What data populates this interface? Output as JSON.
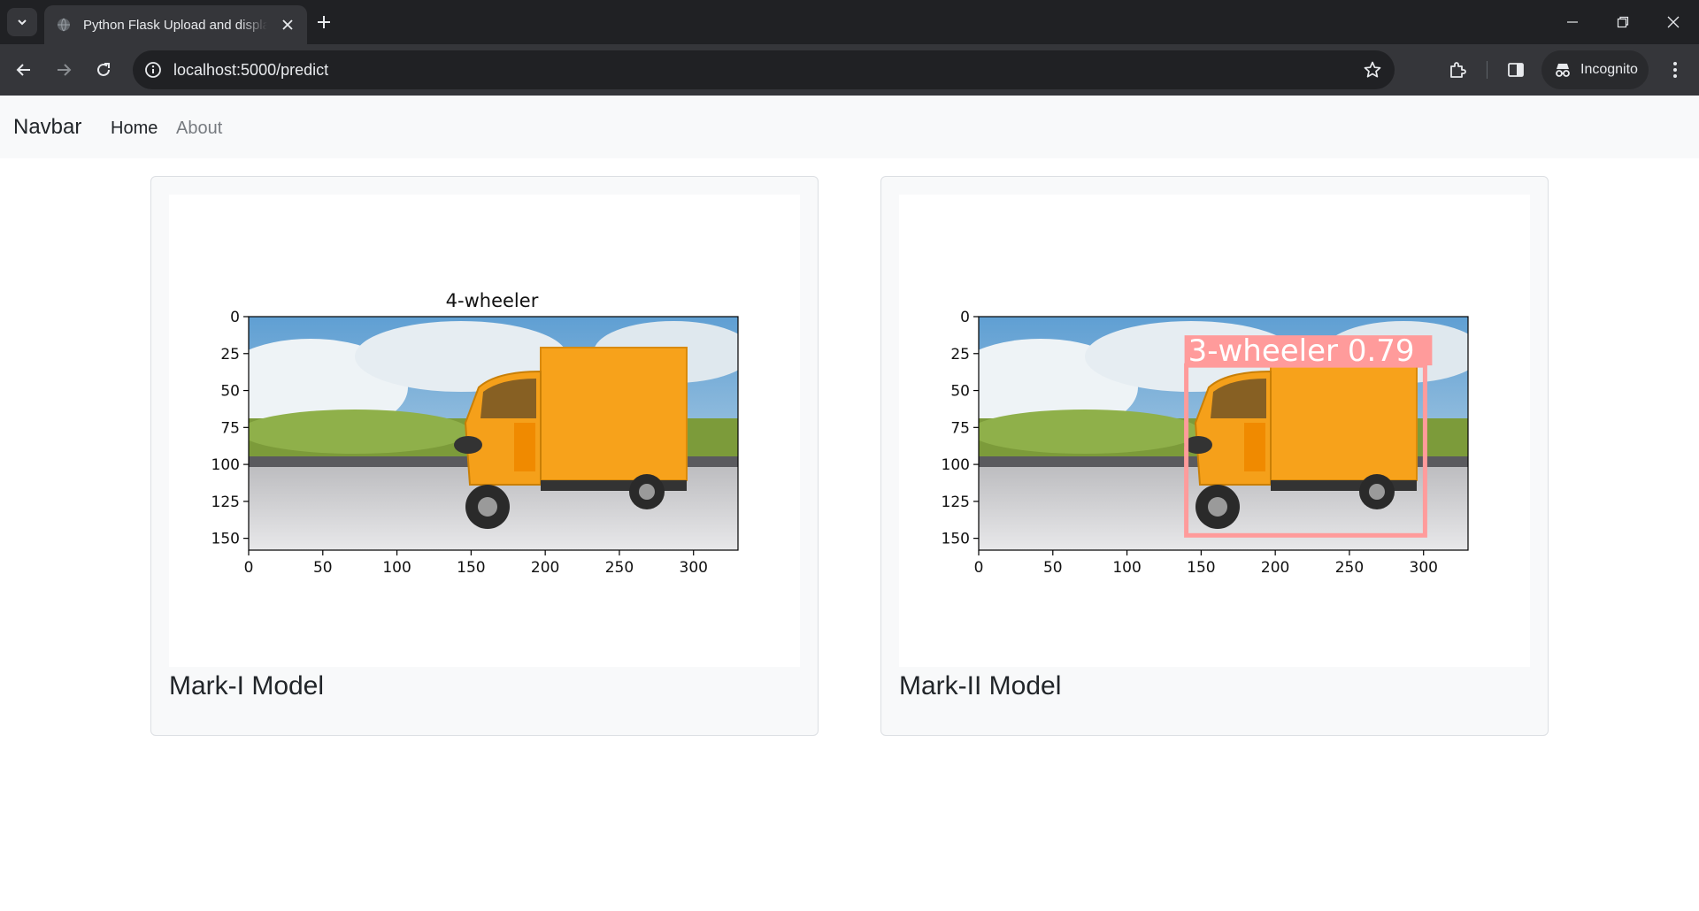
{
  "browser": {
    "tab_title": "Python Flask Upload and display image",
    "url": "localhost:5000/predict",
    "incognito_label": "Incognito"
  },
  "navbar": {
    "brand": "Navbar",
    "links": [
      {
        "label": "Home",
        "active": true
      },
      {
        "label": "About",
        "active": false
      }
    ]
  },
  "cards": [
    {
      "title": "Mark-I Model",
      "plot_title": "4-wheeler",
      "x_ticks": [
        "0",
        "50",
        "100",
        "150",
        "200",
        "250",
        "300"
      ],
      "y_ticks": [
        "0",
        "25",
        "50",
        "75",
        "100",
        "125",
        "150"
      ],
      "image": "orange-three-wheeler-cargo-truck"
    },
    {
      "title": "Mark-II Model",
      "plot_title": "",
      "x_ticks": [
        "0",
        "50",
        "100",
        "150",
        "200",
        "250",
        "300"
      ],
      "y_ticks": [
        "0",
        "25",
        "50",
        "75",
        "100",
        "125",
        "150"
      ],
      "image": "orange-three-wheeler-cargo-truck",
      "detection": {
        "label": "3-wheeler 0.79",
        "x1": 140,
        "y1": 33,
        "x2": 301,
        "y2": 148,
        "color": "#ff9b9b"
      }
    }
  ],
  "colors": {
    "chrome_dark": "#202124",
    "chrome_toolbar": "#35363a",
    "navbar_bg": "#f8f9fa",
    "truck_orange": "#f7a21b",
    "detection_box": "#ff9b9b"
  }
}
